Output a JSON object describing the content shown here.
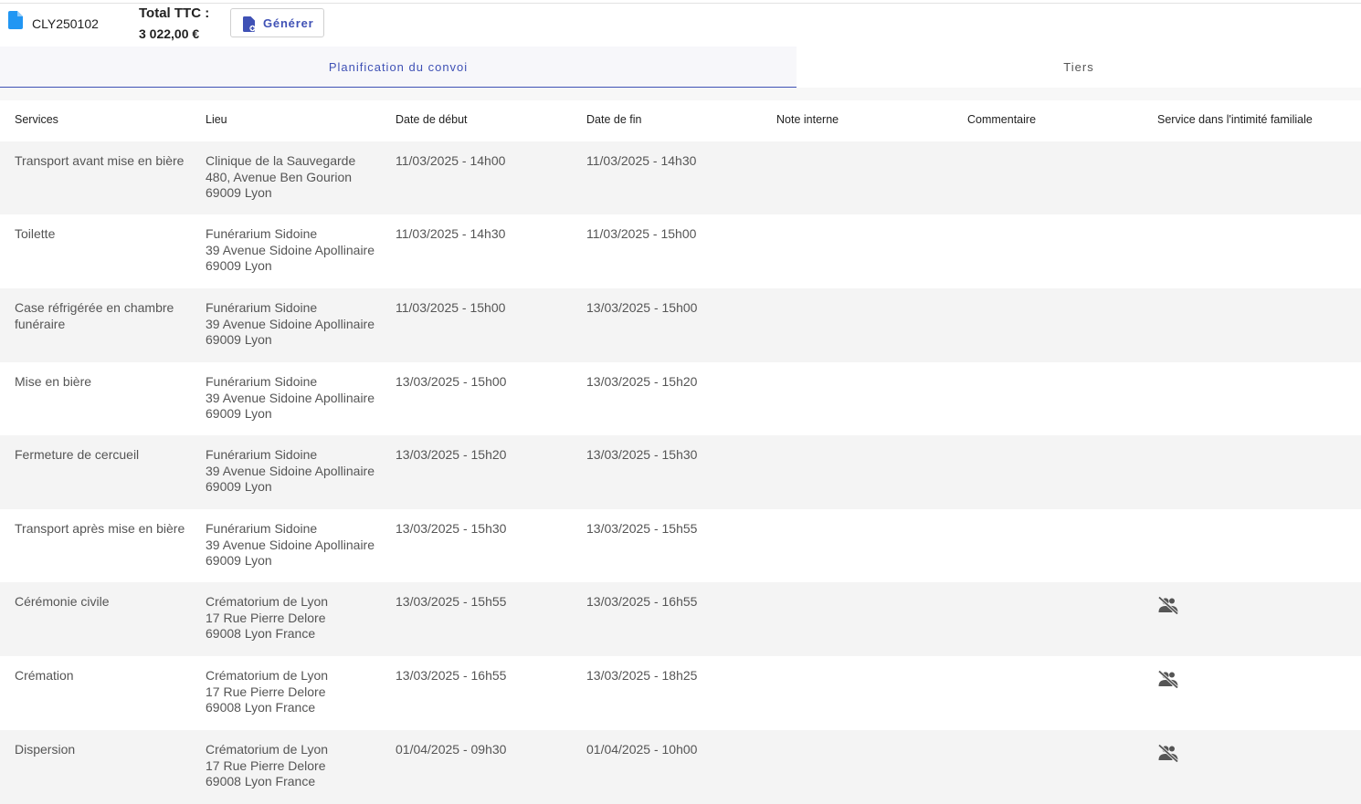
{
  "header": {
    "document_number": "CLY250102",
    "total_label": "Total TTC :",
    "total_value": "3 022,00 €",
    "generate_label": "Générer"
  },
  "tabs": [
    {
      "label": "Planification du convoi",
      "active": true
    },
    {
      "label": "Tiers",
      "active": false
    }
  ],
  "colors": {
    "accent": "#3f51b5",
    "file_icon": "#2196f3",
    "row_shade": "#f4f4f4"
  },
  "table": {
    "headers": [
      "Services",
      "Lieu",
      "Date de début",
      "Date de fin",
      "Note interne",
      "Commentaire",
      "Service dans l'intimité familiale"
    ],
    "rows": [
      {
        "service": "Transport avant mise en bière",
        "lieu": [
          "Clinique de la Sauvegarde",
          "480, Avenue Ben Gourion",
          "69009 Lyon"
        ],
        "debut": "11/03/2025 - 14h00",
        "fin": "11/03/2025 - 14h30",
        "note": "",
        "commentaire": "",
        "intimite": false
      },
      {
        "service": "Toilette",
        "lieu": [
          "Funérarium Sidoine",
          "39 Avenue Sidoine Apollinaire",
          "69009 Lyon"
        ],
        "debut": "11/03/2025 - 14h30",
        "fin": "11/03/2025 - 15h00",
        "note": "",
        "commentaire": "",
        "intimite": false
      },
      {
        "service": "Case réfrigérée en chambre funéraire",
        "lieu": [
          "Funérarium Sidoine",
          "39 Avenue Sidoine Apollinaire",
          "69009 Lyon"
        ],
        "debut": "11/03/2025 - 15h00",
        "fin": "13/03/2025 - 15h00",
        "note": "",
        "commentaire": "",
        "intimite": false
      },
      {
        "service": "Mise en bière",
        "lieu": [
          "Funérarium Sidoine",
          "39 Avenue Sidoine Apollinaire",
          "69009 Lyon"
        ],
        "debut": "13/03/2025 - 15h00",
        "fin": "13/03/2025 - 15h20",
        "note": "",
        "commentaire": "",
        "intimite": false
      },
      {
        "service": "Fermeture de cercueil",
        "lieu": [
          "Funérarium Sidoine",
          "39 Avenue Sidoine Apollinaire",
          "69009 Lyon"
        ],
        "debut": "13/03/2025 - 15h20",
        "fin": "13/03/2025 - 15h30",
        "note": "",
        "commentaire": "",
        "intimite": false
      },
      {
        "service": "Transport après mise en bière",
        "lieu": [
          "Funérarium Sidoine",
          "39 Avenue Sidoine Apollinaire",
          "69009 Lyon"
        ],
        "debut": "13/03/2025 - 15h30",
        "fin": "13/03/2025 - 15h55",
        "note": "",
        "commentaire": "",
        "intimite": false
      },
      {
        "service": "Cérémonie civile",
        "lieu": [
          "Crématorium de Lyon",
          "17 Rue Pierre Delore",
          "69008 Lyon France"
        ],
        "debut": "13/03/2025 - 15h55",
        "fin": "13/03/2025 - 16h55",
        "note": "",
        "commentaire": "",
        "intimite": true
      },
      {
        "service": "Crémation",
        "lieu": [
          "Crématorium de Lyon",
          "17 Rue Pierre Delore",
          "69008 Lyon France"
        ],
        "debut": "13/03/2025 - 16h55",
        "fin": "13/03/2025 - 18h25",
        "note": "",
        "commentaire": "",
        "intimite": true
      },
      {
        "service": "Dispersion",
        "lieu": [
          "Crématorium de Lyon",
          "17 Rue Pierre Delore",
          "69008 Lyon France"
        ],
        "debut": "01/04/2025 - 09h30",
        "fin": "01/04/2025 - 10h00",
        "note": "",
        "commentaire": "",
        "intimite": true
      }
    ]
  }
}
